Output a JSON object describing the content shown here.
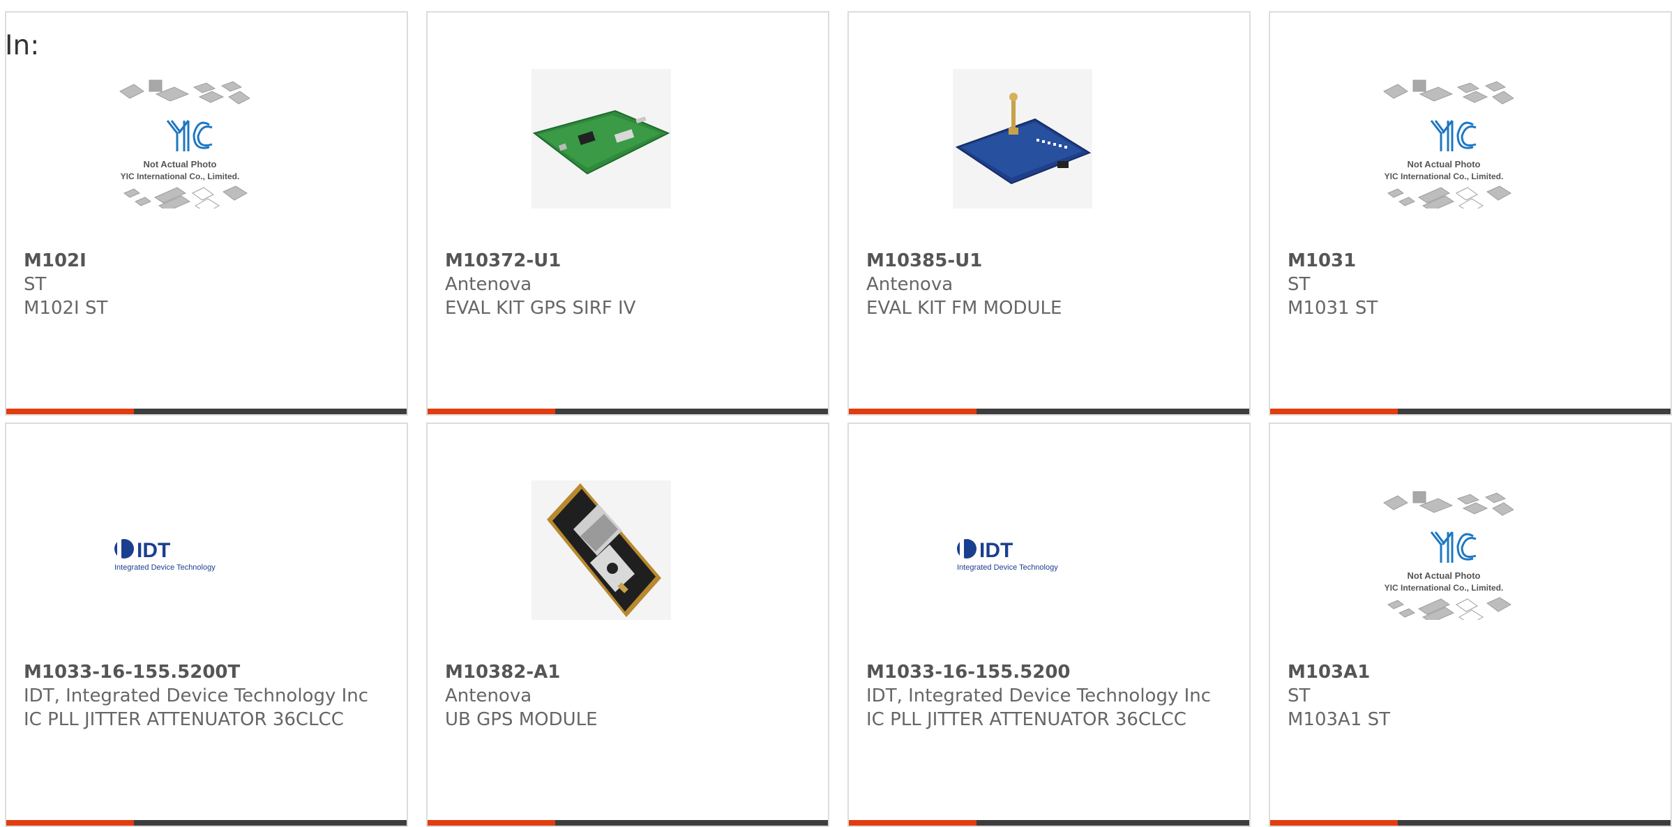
{
  "page": {
    "label": "In:"
  },
  "colors": {
    "accent": "#e23c0f",
    "bar": "#3d3d3d",
    "border": "#dcdcdc",
    "text": "#666666"
  },
  "placeholder": {
    "line1": "Not Actual Photo",
    "line2": "YIC International Co., Limited.",
    "logo": "YIC"
  },
  "idt_logo": {
    "brand": "IDT",
    "tagline": "Integrated Device Technology"
  },
  "products": [
    {
      "part": "M102I",
      "maker": "ST",
      "desc": "M102I ST",
      "image": "yic-placeholder"
    },
    {
      "part": "M10372-U1",
      "maker": "Antenova",
      "desc": "EVAL KIT GPS SIRF IV",
      "image": "green-pcb"
    },
    {
      "part": "M10385-U1",
      "maker": "Antenova",
      "desc": "EVAL KIT FM MODULE",
      "image": "blue-pcb"
    },
    {
      "part": "M1031",
      "maker": "ST",
      "desc": "M1031 ST",
      "image": "yic-placeholder"
    },
    {
      "part": "M1033-16-155.5200T",
      "maker": "IDT, Integrated Device Technology Inc",
      "desc": "IC PLL JITTER ATTENUATOR 36CLCC",
      "image": "idt-logo"
    },
    {
      "part": "M10382-A1",
      "maker": "Antenova",
      "desc": "UB GPS MODULE",
      "image": "gps-module"
    },
    {
      "part": "M1033-16-155.5200",
      "maker": "IDT, Integrated Device Technology Inc",
      "desc": "IC PLL JITTER ATTENUATOR 36CLCC",
      "image": "idt-logo"
    },
    {
      "part": "M103A1",
      "maker": "ST",
      "desc": "M103A1 ST",
      "image": "yic-placeholder"
    }
  ]
}
